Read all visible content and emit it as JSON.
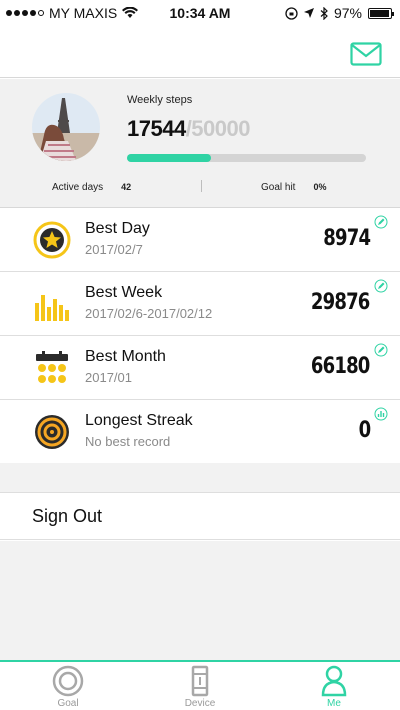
{
  "status_bar": {
    "carrier": "MY MAXIS",
    "time": "10:34 AM",
    "battery": "97%"
  },
  "profile": {
    "weekly_label": "Weekly steps",
    "steps": "17544",
    "goal": "/50000",
    "progress_fraction": 0.3509,
    "active_days_label": "Active days",
    "active_days_value": "42",
    "goal_hit_label": "Goal hit",
    "goal_hit_value": "0%"
  },
  "records": [
    {
      "title": "Best Day",
      "subtitle": "2017/02/7",
      "value": "8974",
      "icon": "star-medal-icon",
      "action_icon": "pencil-icon"
    },
    {
      "title": "Best Week",
      "subtitle": "2017/02/6-2017/02/12",
      "value": "29876",
      "icon": "bar-chart-icon",
      "action_icon": "pencil-icon"
    },
    {
      "title": "Best Month",
      "subtitle": "2017/01",
      "value": "66180",
      "icon": "calendar-icon",
      "action_icon": "pencil-icon"
    },
    {
      "title": "Longest Streak",
      "subtitle": "No best record",
      "value": "0",
      "icon": "target-icon",
      "action_icon": "chart-icon"
    }
  ],
  "sign_out_label": "Sign Out",
  "tabs": [
    {
      "label": "Goal",
      "icon": "target-ring-icon",
      "active": false
    },
    {
      "label": "Device",
      "icon": "device-band-icon",
      "active": false
    },
    {
      "label": "Me",
      "icon": "person-icon",
      "active": true
    }
  ],
  "colors": {
    "accent": "#2fd3a4",
    "medal_yellow": "#f5c518",
    "medal_dark": "#2b2b2b"
  }
}
